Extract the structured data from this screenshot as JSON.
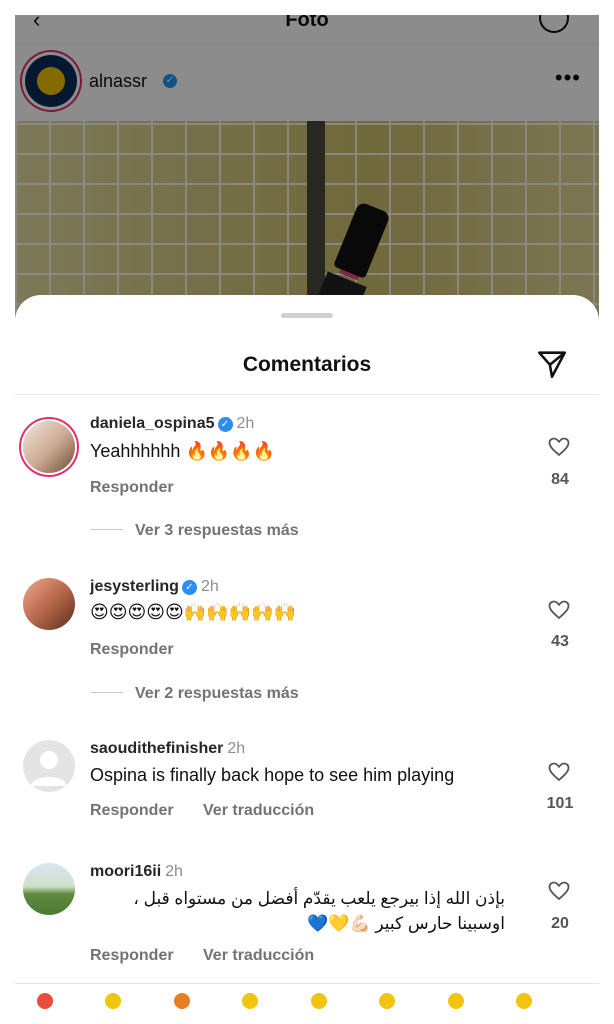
{
  "header": {
    "title": "Foto",
    "account_username": "alnassr"
  },
  "sheet": {
    "title": "Comentarios"
  },
  "comments": [
    {
      "username": "daniela_ospina5",
      "verified": true,
      "time": "2h",
      "text": "Yeahhhhhh 🔥🔥🔥🔥",
      "reply_label": "Responder",
      "likes": "84",
      "more_replies": "Ver 3 respuestas más"
    },
    {
      "username": "jesysterling",
      "verified": true,
      "time": "2h",
      "text": "😍😍😍😍😍🙌🙌🙌🙌🙌",
      "reply_label": "Responder",
      "likes": "43",
      "more_replies": "Ver 2 respuestas más"
    },
    {
      "username": "saoudithefinisher",
      "verified": false,
      "time": "2h",
      "text": "Ospina is finally back hope to see him playing",
      "reply_label": "Responder",
      "translate_label": "Ver traducción",
      "likes": "101"
    },
    {
      "username": "moori16ii",
      "verified": false,
      "time": "2h",
      "text_line1": "بإذن الله إذا بيرجع يلعب يقدّم أفضل من مستواه قبل ،",
      "text_line2": "اوسبينا حارس كبير 💪🏻💛💙",
      "reply_label": "Responder",
      "translate_label": "Ver traducción",
      "likes": "20"
    }
  ],
  "icons": {
    "send": "paper-plane-icon",
    "heart": "heart-outline-icon",
    "verified": "verified-badge-icon"
  },
  "colors": {
    "verified": "#2b8ef0",
    "story_ring": "#e1306c",
    "muted": "#737373"
  }
}
